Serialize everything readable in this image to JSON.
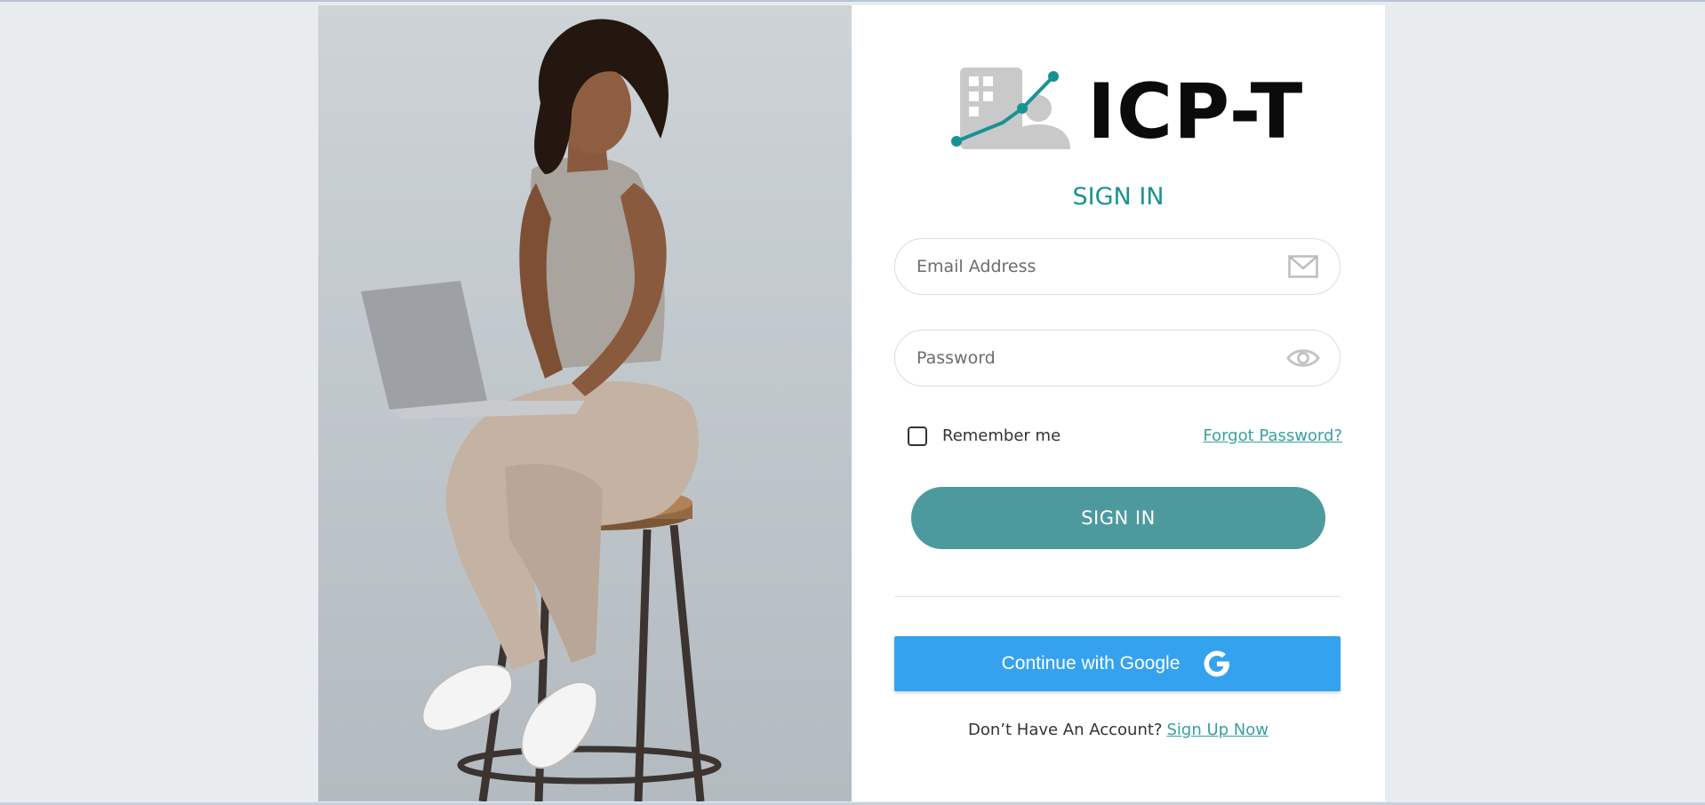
{
  "brand": {
    "name": "ICP-T",
    "accent_color": "#1b9294",
    "logo_icon": "building-user-growth-icon"
  },
  "hero": {
    "image": "woman-with-laptop-on-stool-photo"
  },
  "signin": {
    "title": "SIGN IN",
    "email_placeholder": "Email Address",
    "password_placeholder": "Password",
    "remember_label": "Remember me",
    "forgot_label": "Forgot Password?",
    "submit_label": "SIGN IN",
    "submit_color": "#4c9a9e"
  },
  "social": {
    "google_label": "Continue with Google",
    "google_color": "#35a2ef"
  },
  "signup": {
    "prompt": "Don’t Have An Account?",
    "link": "Sign Up Now"
  }
}
